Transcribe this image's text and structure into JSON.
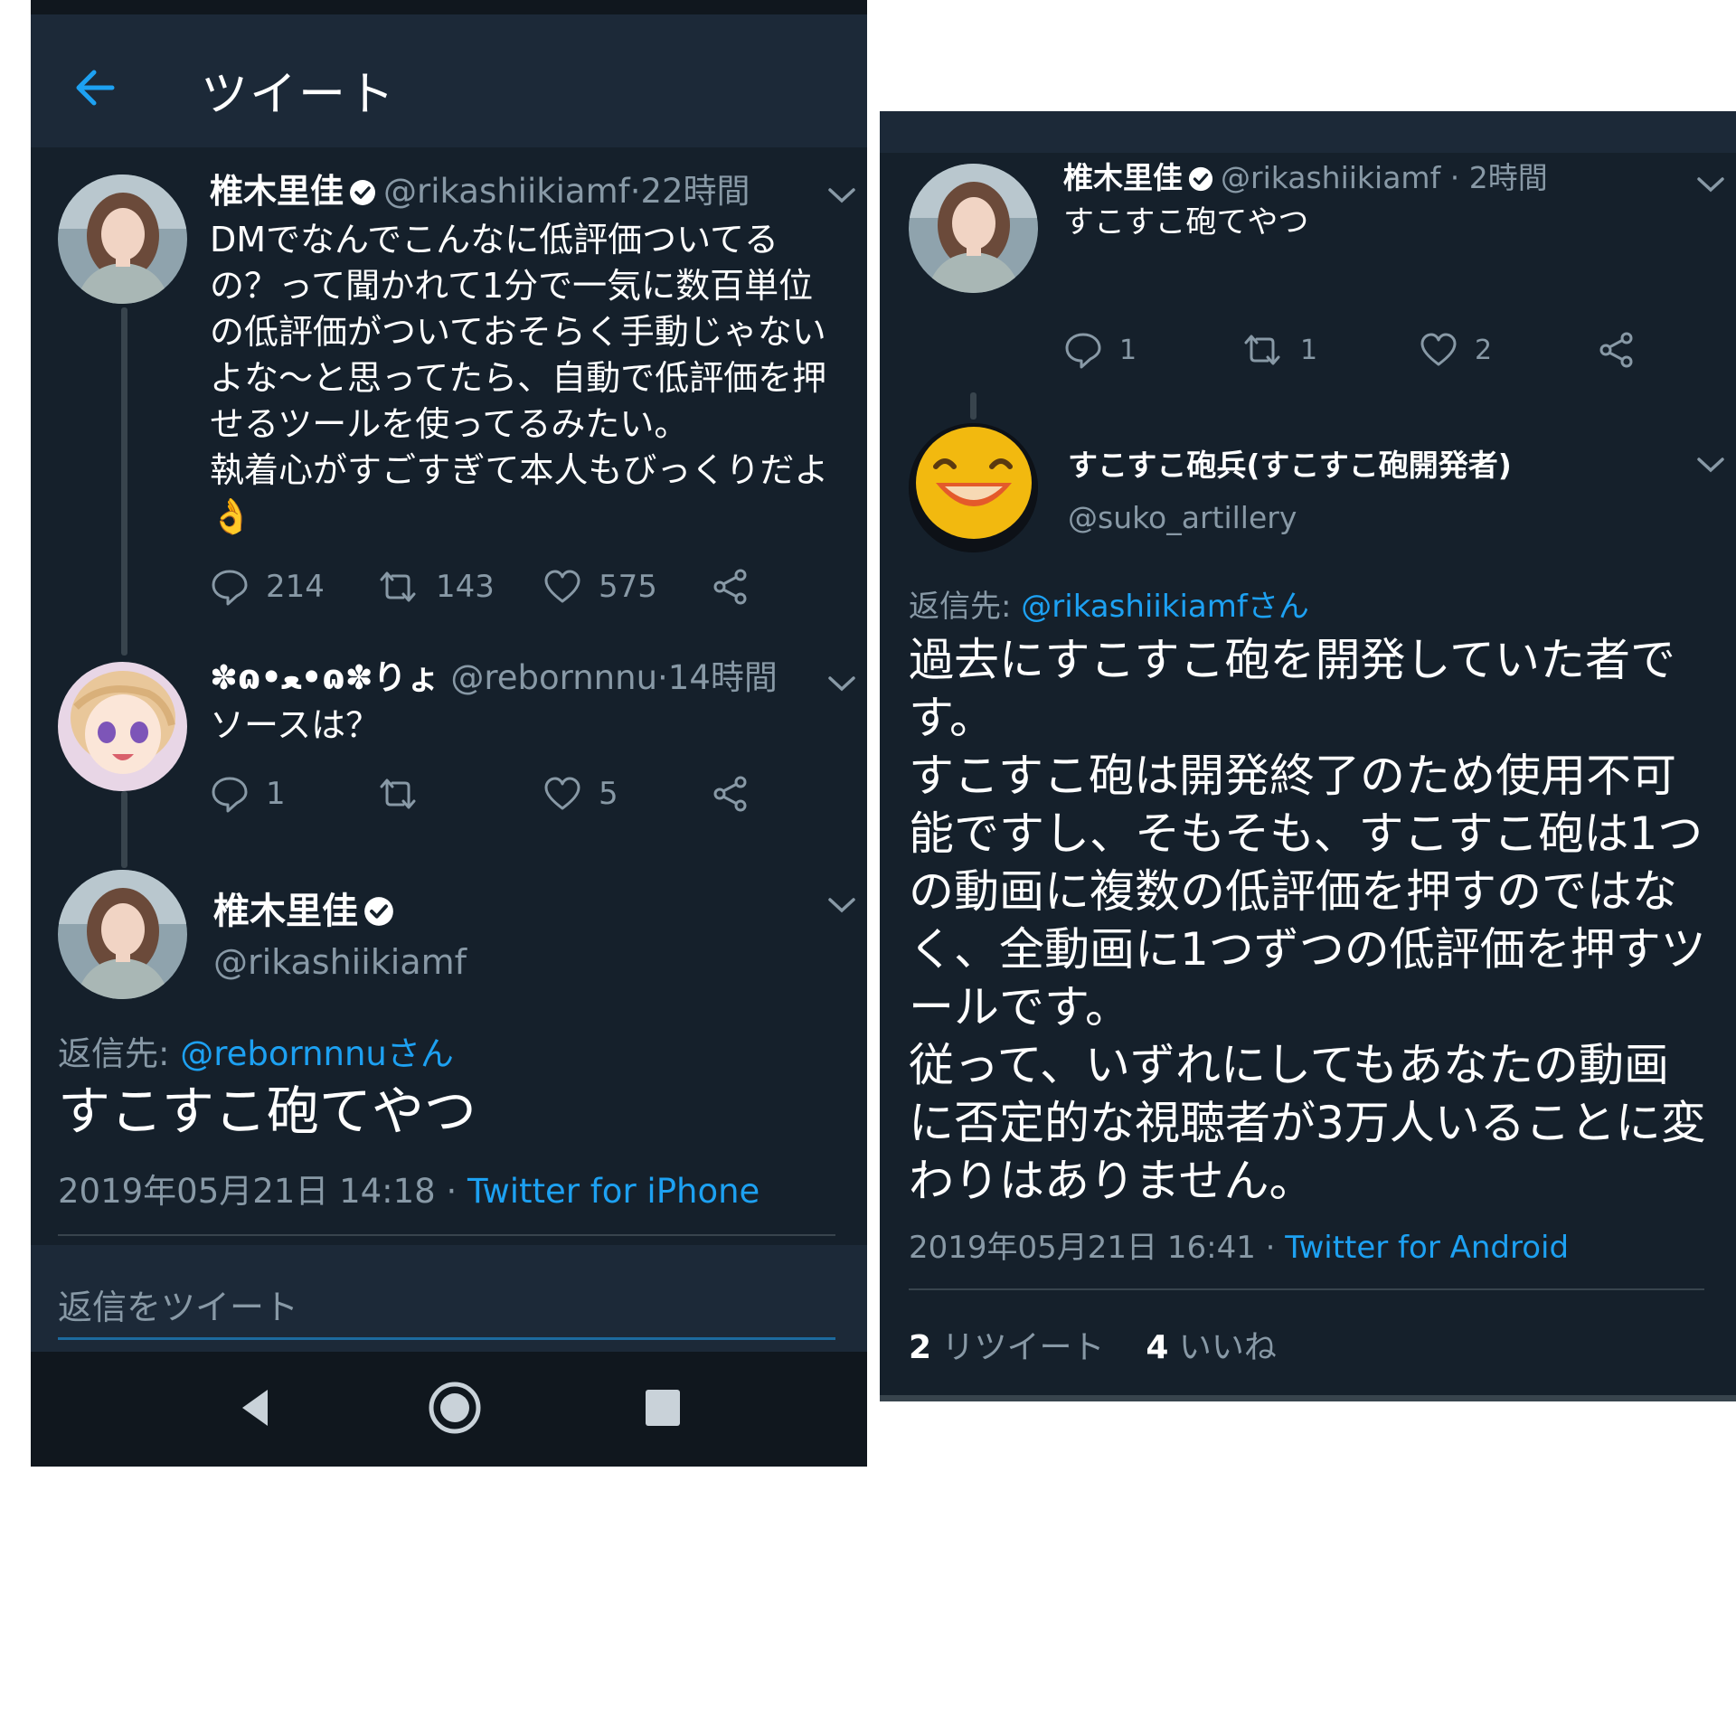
{
  "left": {
    "header": {
      "title": "ツイート"
    },
    "tweets": [
      {
        "name": "椎木里佳",
        "handle": "@rikashiikiamf",
        "dot": "·",
        "time": "22時間",
        "text": "DMでなんでこんなに低評価ついてる\nの？って聞かれて1分で一気に数百単位\nの低評価がついておそらく手動じゃない\nよな〜と思ってたら、自動で低評価を押\nせるツールを使ってるみたい。\n執着心がすごすぎて本人もびっくりだよ\n👌",
        "reply_count": "214",
        "retweet_count": "143",
        "like_count": "575"
      },
      {
        "name": "✽ɷ•ﻌ•ɷ✽りょ",
        "handle": "@rebornnnu",
        "dot": "·",
        "time": "14時間",
        "text": "ソースは？",
        "reply_count": "1",
        "retweet_count": "",
        "like_count": "5"
      }
    ],
    "focus": {
      "name": "椎木里佳",
      "handle": "@rikashiikiamf",
      "reply_to_label": "返信先:",
      "reply_to_mention": "@rebornnnuさん",
      "text": "すこすこ砲てやつ",
      "date": "2019年05月21日 14:18",
      "dot": "·",
      "client": "Twitter for iPhone"
    },
    "reply_placeholder": "返信をツイート"
  },
  "right": {
    "tweet": {
      "name": "椎木里佳",
      "handle": "@rikashiikiamf",
      "dot": "·",
      "time": "2時間",
      "text": "すこすこ砲てやつ",
      "reply_count": "1",
      "retweet_count": "1",
      "like_count": "2"
    },
    "focus": {
      "name": "すこすこ砲兵(すこすこ砲開発者)",
      "handle": "@suko_artillery",
      "reply_to_label": "返信先:",
      "reply_to_mention": "@rikashiikiamfさん",
      "text": "過去にすこすこ砲を開発していた者で\nす。\nすこすこ砲は開発終了のため使用不可\n能ですし、そもそも、すこすこ砲は1つ\nの動画に複数の低評価を押すのではな\nく、全動画に1つずつの低評価を押すツ\nールです。\n従って、いずれにしてもあなたの動画\nに否定的な視聴者が3万人いることに変\nわりはありません。",
      "date": "2019年05月21日 16:41",
      "dot": "·",
      "client": "Twitter for Android",
      "retweets_num": "2",
      "retweets_label": "リツイート",
      "likes_num": "4",
      "likes_label": "いいね"
    }
  },
  "colors": {
    "background": "#15202b",
    "header": "#1c2938",
    "accent": "#1da1f2",
    "muted": "#8899a6",
    "divider": "#38444d"
  }
}
